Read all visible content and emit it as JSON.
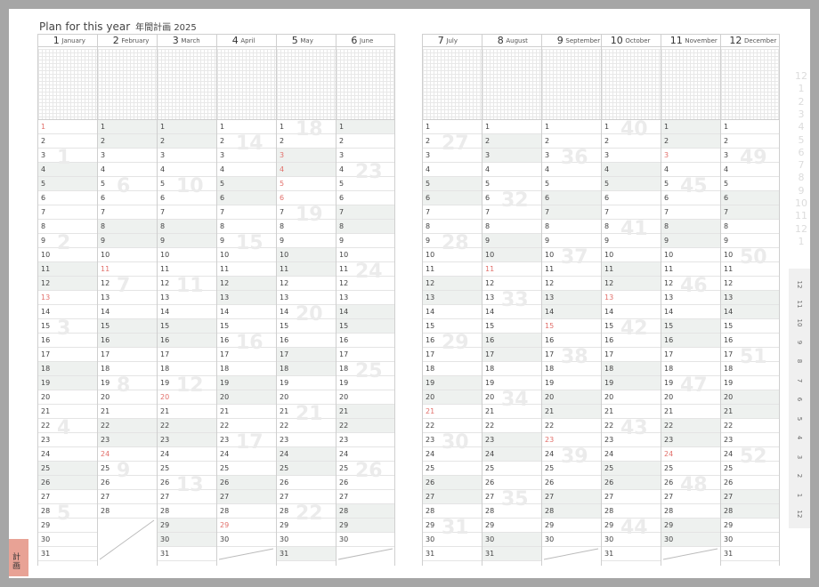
{
  "title": {
    "main": "Plan for this year",
    "sub": "年間計画 2025"
  },
  "months": [
    {
      "num": "1",
      "name": "January",
      "days": 31,
      "weekends": [
        4,
        5,
        11,
        12,
        18,
        19,
        25,
        26
      ],
      "holidays": [
        1,
        13
      ]
    },
    {
      "num": "2",
      "name": "February",
      "days": 28,
      "weekends": [
        1,
        2,
        8,
        9,
        15,
        16,
        22,
        23
      ],
      "holidays": [
        11,
        24
      ]
    },
    {
      "num": "3",
      "name": "March",
      "days": 31,
      "weekends": [
        1,
        2,
        8,
        9,
        15,
        16,
        22,
        23,
        29,
        30
      ],
      "holidays": [
        20
      ]
    },
    {
      "num": "4",
      "name": "April",
      "days": 30,
      "weekends": [
        5,
        6,
        12,
        13,
        19,
        20,
        26,
        27
      ],
      "holidays": [
        29
      ]
    },
    {
      "num": "5",
      "name": "May",
      "days": 31,
      "weekends": [
        3,
        4,
        10,
        11,
        17,
        18,
        24,
        25,
        31
      ],
      "holidays": [
        3,
        4,
        5,
        6
      ]
    },
    {
      "num": "6",
      "name": "June",
      "days": 30,
      "weekends": [
        1,
        7,
        8,
        14,
        15,
        21,
        22,
        28,
        29
      ],
      "holidays": []
    },
    {
      "num": "7",
      "name": "July",
      "days": 31,
      "weekends": [
        5,
        6,
        12,
        13,
        19,
        20,
        26,
        27
      ],
      "holidays": [
        21
      ]
    },
    {
      "num": "8",
      "name": "August",
      "days": 31,
      "weekends": [
        2,
        3,
        9,
        10,
        16,
        17,
        23,
        24,
        30,
        31
      ],
      "holidays": [
        11
      ]
    },
    {
      "num": "9",
      "name": "September",
      "days": 30,
      "weekends": [
        6,
        7,
        13,
        14,
        20,
        21,
        27,
        28
      ],
      "holidays": [
        15,
        23
      ]
    },
    {
      "num": "10",
      "name": "October",
      "days": 31,
      "weekends": [
        4,
        5,
        11,
        12,
        18,
        19,
        25,
        26
      ],
      "holidays": [
        13
      ]
    },
    {
      "num": "11",
      "name": "November",
      "days": 30,
      "weekends": [
        1,
        2,
        8,
        9,
        15,
        16,
        22,
        23,
        29,
        30
      ],
      "holidays": [
        3,
        24
      ]
    },
    {
      "num": "12",
      "name": "December",
      "days": 31,
      "weekends": [
        6,
        7,
        13,
        14,
        20,
        21,
        27,
        28
      ],
      "holidays": []
    }
  ],
  "weeks": {
    "left": [
      {
        "m": 0,
        "d": 3,
        "n": "1"
      },
      {
        "m": 0,
        "d": 9,
        "n": "2"
      },
      {
        "m": 0,
        "d": 15,
        "n": "3"
      },
      {
        "m": 0,
        "d": 22,
        "n": "4"
      },
      {
        "m": 0,
        "d": 28,
        "n": "5"
      },
      {
        "m": 1,
        "d": 5,
        "n": "6"
      },
      {
        "m": 1,
        "d": 12,
        "n": "7"
      },
      {
        "m": 1,
        "d": 19,
        "n": "8"
      },
      {
        "m": 1,
        "d": 25,
        "n": "9"
      },
      {
        "m": 2,
        "d": 5,
        "n": "10"
      },
      {
        "m": 2,
        "d": 12,
        "n": "11"
      },
      {
        "m": 2,
        "d": 19,
        "n": "12"
      },
      {
        "m": 2,
        "d": 26,
        "n": "13"
      },
      {
        "m": 3,
        "d": 2,
        "n": "14"
      },
      {
        "m": 3,
        "d": 9,
        "n": "15"
      },
      {
        "m": 3,
        "d": 16,
        "n": "16"
      },
      {
        "m": 3,
        "d": 23,
        "n": "17"
      },
      {
        "m": 4,
        "d": 1,
        "n": "18"
      },
      {
        "m": 4,
        "d": 7,
        "n": "19"
      },
      {
        "m": 4,
        "d": 14,
        "n": "20"
      },
      {
        "m": 4,
        "d": 21,
        "n": "21"
      },
      {
        "m": 4,
        "d": 28,
        "n": "22"
      },
      {
        "m": 5,
        "d": 4,
        "n": "23"
      },
      {
        "m": 5,
        "d": 11,
        "n": "24"
      },
      {
        "m": 5,
        "d": 18,
        "n": "25"
      },
      {
        "m": 5,
        "d": 25,
        "n": "26"
      }
    ],
    "right": [
      {
        "m": 6,
        "d": 2,
        "n": "27"
      },
      {
        "m": 6,
        "d": 9,
        "n": "28"
      },
      {
        "m": 6,
        "d": 16,
        "n": "29"
      },
      {
        "m": 6,
        "d": 23,
        "n": "30"
      },
      {
        "m": 6,
        "d": 29,
        "n": "31"
      },
      {
        "m": 7,
        "d": 6,
        "n": "32"
      },
      {
        "m": 7,
        "d": 13,
        "n": "33"
      },
      {
        "m": 7,
        "d": 20,
        "n": "34"
      },
      {
        "m": 7,
        "d": 27,
        "n": "35"
      },
      {
        "m": 8,
        "d": 3,
        "n": "36"
      },
      {
        "m": 8,
        "d": 10,
        "n": "37"
      },
      {
        "m": 8,
        "d": 17,
        "n": "38"
      },
      {
        "m": 8,
        "d": 24,
        "n": "39"
      },
      {
        "m": 9,
        "d": 1,
        "n": "40"
      },
      {
        "m": 9,
        "d": 8,
        "n": "41"
      },
      {
        "m": 9,
        "d": 15,
        "n": "42"
      },
      {
        "m": 9,
        "d": 22,
        "n": "43"
      },
      {
        "m": 9,
        "d": 29,
        "n": "44"
      },
      {
        "m": 10,
        "d": 5,
        "n": "45"
      },
      {
        "m": 10,
        "d": 12,
        "n": "46"
      },
      {
        "m": 10,
        "d": 19,
        "n": "47"
      },
      {
        "m": 10,
        "d": 26,
        "n": "48"
      },
      {
        "m": 11,
        "d": 3,
        "n": "49"
      },
      {
        "m": 11,
        "d": 10,
        "n": "50"
      },
      {
        "m": 11,
        "d": 17,
        "n": "51"
      },
      {
        "m": 11,
        "d": 24,
        "n": "52"
      }
    ]
  },
  "side_index": [
    "12",
    "1",
    "2",
    "3",
    "4",
    "5",
    "6",
    "7",
    "8",
    "9",
    "10",
    "11",
    "12",
    "1"
  ],
  "side_tabs": [
    "12",
    "11",
    "10",
    "9",
    "8",
    "7",
    "6",
    "5",
    "4",
    "3",
    "2",
    "1",
    "12"
  ],
  "corner_tab": "計画",
  "colors": {
    "holiday": "#e2706b",
    "weekend_fill": "#eef1ef",
    "corner": "#e8a295"
  }
}
